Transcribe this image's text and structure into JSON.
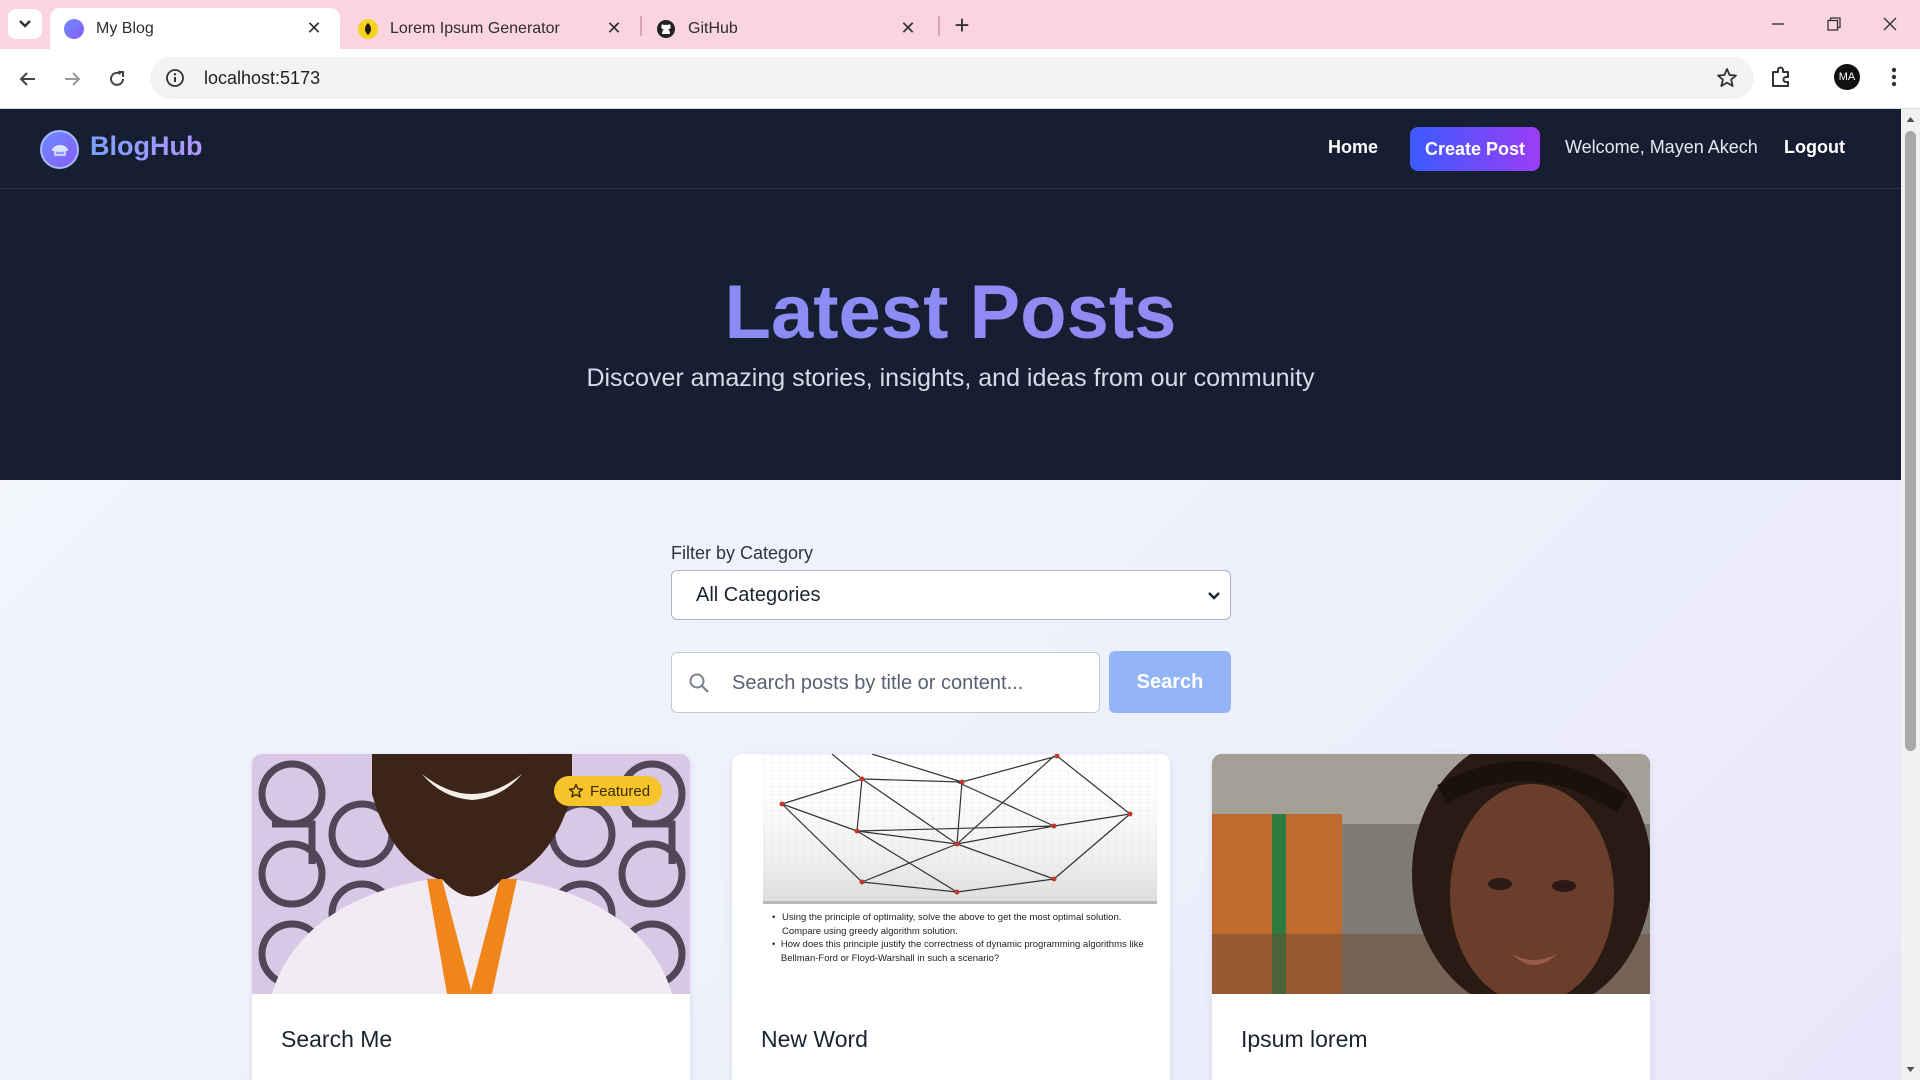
{
  "browser": {
    "tabs": [
      {
        "title": "My Blog",
        "active": true,
        "favicon": "blog-favicon"
      },
      {
        "title": "Lorem Ipsum Generator",
        "active": false,
        "favicon": "lorem-favicon"
      },
      {
        "title": "GitHub",
        "active": false,
        "favicon": "github-favicon"
      }
    ],
    "url": "localhost:5173",
    "profile_initials": "MA",
    "colors": {
      "tab_strip": "#fbd4e1"
    }
  },
  "site": {
    "brand": "BlogHub",
    "nav": {
      "home": "Home",
      "create_post": "Create Post",
      "welcome": "Welcome, Mayen Akech",
      "logout": "Logout"
    },
    "colors": {
      "header_bg": "#161f32",
      "accent_from": "#3b5bff",
      "accent_to": "#9b3df6"
    }
  },
  "hero": {
    "title": "Latest Posts",
    "subtitle": "Discover amazing stories, insights, and ideas from our community"
  },
  "filters": {
    "category_label": "Filter by Category",
    "category_selected": "All Categories",
    "search_placeholder": "Search posts by title or content...",
    "search_button": "Search"
  },
  "posts": [
    {
      "title": "Search Me",
      "featured": true,
      "badge": "Featured",
      "image": "photo-of-smiling-man-with-orange-lanyard"
    },
    {
      "title": "New Word",
      "featured": false,
      "image": "graph-problem-worksheet",
      "image_text": [
        "Using the principle of optimality, solve the above to get the most optimal solution. Compare using greedy algorithm solution.",
        "How does this principle justify the correctness of dynamic programming algorithms like Bellman-Ford or Floyd-Warshall in such a scenario?"
      ]
    },
    {
      "title": "Ipsum lorem",
      "featured": false,
      "image": "portrait-of-woman-with-locs"
    }
  ]
}
